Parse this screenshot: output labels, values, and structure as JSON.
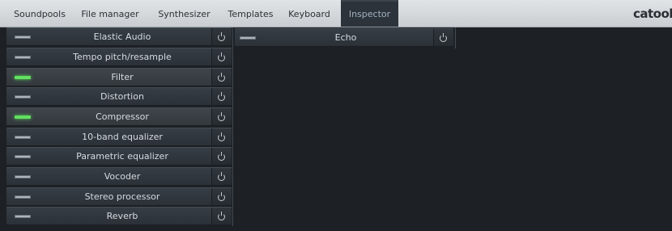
{
  "tabs": [
    {
      "label": "Soundpools",
      "active": false
    },
    {
      "label": "File manager",
      "active": false
    },
    {
      "label": "Synthesizer",
      "active": false
    },
    {
      "label": "Templates",
      "active": false
    },
    {
      "label": "Keyboard",
      "active": false
    },
    {
      "label": "Inspector",
      "active": true
    }
  ],
  "logo": "catooh",
  "effects": [
    {
      "label": "Elastic Audio",
      "enabled": false
    },
    {
      "label": "Tempo pitch/resample",
      "enabled": false
    },
    {
      "label": "Filter",
      "enabled": true
    },
    {
      "label": "Distortion",
      "enabled": false
    },
    {
      "label": "Compressor",
      "enabled": true
    },
    {
      "label": "10-band equalizer",
      "enabled": false
    },
    {
      "label": "Parametric equalizer",
      "enabled": false
    },
    {
      "label": "Vocoder",
      "enabled": false
    },
    {
      "label": "Stereo processor",
      "enabled": false
    },
    {
      "label": "Reverb",
      "enabled": false
    }
  ],
  "slots": [
    {
      "label": "Echo",
      "enabled": false
    }
  ],
  "colors": {
    "accent_active_tab": "#2d333a",
    "led_on": "#62e060",
    "led_off": "#aeb4ba"
  }
}
